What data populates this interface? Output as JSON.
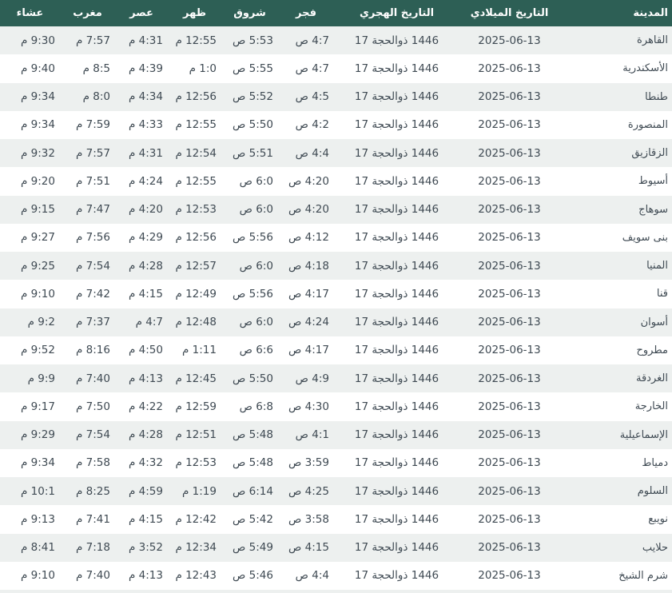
{
  "colors": {
    "header_bg": "#2d5f55",
    "header_text": "#ffffff",
    "row_alt_bg": "#edf0ef",
    "row_bg": "#ffffff",
    "cell_text": "#3f4a53"
  },
  "table": {
    "columns": [
      {
        "key": "isha",
        "label": "عشاء"
      },
      {
        "key": "maghrib",
        "label": "مغرب"
      },
      {
        "key": "asr",
        "label": "عصر"
      },
      {
        "key": "dhuhr",
        "label": "ظهر"
      },
      {
        "key": "sunrise",
        "label": "شروق"
      },
      {
        "key": "fajr",
        "label": "فجر"
      },
      {
        "key": "hijri",
        "label": "التاريخ الهجري"
      },
      {
        "key": "gregorian",
        "label": "التاريخ الميلادي"
      },
      {
        "key": "city",
        "label": "المدينة"
      }
    ],
    "rows": [
      {
        "city": "القاهرة",
        "gregorian": "2025-06-13",
        "hijri": [
          "17",
          "ذوالحجة",
          "1446"
        ],
        "fajr": "4:7 ص",
        "sunrise": "5:53 ص",
        "dhuhr": "12:55 م",
        "asr": "4:31 م",
        "maghrib": "7:57 م",
        "isha": "9:30 م"
      },
      {
        "city": "الأسكندرية",
        "gregorian": "2025-06-13",
        "hijri": [
          "17",
          "ذوالحجة",
          "1446"
        ],
        "fajr": "4:7 ص",
        "sunrise": "5:55 ص",
        "dhuhr": "1:0 م",
        "asr": "4:39 م",
        "maghrib": "8:5 م",
        "isha": "9:40 م"
      },
      {
        "city": "طنطا",
        "gregorian": "2025-06-13",
        "hijri": [
          "17",
          "ذوالحجة",
          "1446"
        ],
        "fajr": "4:5 ص",
        "sunrise": "5:52 ص",
        "dhuhr": "12:56 م",
        "asr": "4:34 م",
        "maghrib": "8:0 م",
        "isha": "9:34 م"
      },
      {
        "city": "المنصورة",
        "gregorian": "2025-06-13",
        "hijri": [
          "17",
          "ذوالحجة",
          "1446"
        ],
        "fajr": "4:2 ص",
        "sunrise": "5:50 ص",
        "dhuhr": "12:55 م",
        "asr": "4:33 م",
        "maghrib": "7:59 م",
        "isha": "9:34 م"
      },
      {
        "city": "الزقازيق",
        "gregorian": "2025-06-13",
        "hijri": [
          "17",
          "ذوالحجة",
          "1446"
        ],
        "fajr": "4:4 ص",
        "sunrise": "5:51 ص",
        "dhuhr": "12:54 م",
        "asr": "4:31 م",
        "maghrib": "7:57 م",
        "isha": "9:32 م"
      },
      {
        "city": "أسيوط",
        "gregorian": "2025-06-13",
        "hijri": [
          "17",
          "ذوالحجة",
          "1446"
        ],
        "fajr": "4:20 ص",
        "sunrise": "6:0 ص",
        "dhuhr": "12:55 م",
        "asr": "4:24 م",
        "maghrib": "7:51 م",
        "isha": "9:20 م"
      },
      {
        "city": "سوهاج",
        "gregorian": "2025-06-13",
        "hijri": [
          "17",
          "ذوالحجة",
          "1446"
        ],
        "fajr": "4:20 ص",
        "sunrise": "6:0 ص",
        "dhuhr": "12:53 م",
        "asr": "4:20 م",
        "maghrib": "7:47 م",
        "isha": "9:15 م"
      },
      {
        "city": "بنى سويف",
        "gregorian": "2025-06-13",
        "hijri": [
          "17",
          "ذوالحجة",
          "1446"
        ],
        "fajr": "4:12 ص",
        "sunrise": "5:56 ص",
        "dhuhr": "12:56 م",
        "asr": "4:29 م",
        "maghrib": "7:56 م",
        "isha": "9:27 م"
      },
      {
        "city": "المنيا",
        "gregorian": "2025-06-13",
        "hijri": [
          "17",
          "ذوالحجة",
          "1446"
        ],
        "fajr": "4:18 ص",
        "sunrise": "6:0 ص",
        "dhuhr": "12:57 م",
        "asr": "4:28 م",
        "maghrib": "7:54 م",
        "isha": "9:25 م"
      },
      {
        "city": "قنا",
        "gregorian": "2025-06-13",
        "hijri": [
          "17",
          "ذوالحجة",
          "1446"
        ],
        "fajr": "4:17 ص",
        "sunrise": "5:56 ص",
        "dhuhr": "12:49 م",
        "asr": "4:15 م",
        "maghrib": "7:42 م",
        "isha": "9:10 م"
      },
      {
        "city": "أسوان",
        "gregorian": "2025-06-13",
        "hijri": [
          "17",
          "ذوالحجة",
          "1446"
        ],
        "fajr": "4:24 ص",
        "sunrise": "6:0 ص",
        "dhuhr": "12:48 م",
        "asr": "4:7 م",
        "maghrib": "7:37 م",
        "isha": "9:2 م"
      },
      {
        "city": "مطروح",
        "gregorian": "2025-06-13",
        "hijri": [
          "17",
          "ذوالحجة",
          "1446"
        ],
        "fajr": "4:17 ص",
        "sunrise": "6:6 ص",
        "dhuhr": "1:11 م",
        "asr": "4:50 م",
        "maghrib": "8:16 م",
        "isha": "9:52 م"
      },
      {
        "city": "الغردقة",
        "gregorian": "2025-06-13",
        "hijri": [
          "17",
          "ذوالحجة",
          "1446"
        ],
        "fajr": "4:9 ص",
        "sunrise": "5:50 ص",
        "dhuhr": "12:45 م",
        "asr": "4:13 م",
        "maghrib": "7:40 م",
        "isha": "9:9 م"
      },
      {
        "city": "الخارجة",
        "gregorian": "2025-06-13",
        "hijri": [
          "17",
          "ذوالحجة",
          "1446"
        ],
        "fajr": "4:30 ص",
        "sunrise": "6:8 ص",
        "dhuhr": "12:59 م",
        "asr": "4:22 م",
        "maghrib": "7:50 م",
        "isha": "9:17 م"
      },
      {
        "city": "الإسماعيلية",
        "gregorian": "2025-06-13",
        "hijri": [
          "17",
          "ذوالحجة",
          "1446"
        ],
        "fajr": "4:1 ص",
        "sunrise": "5:48 ص",
        "dhuhr": "12:51 م",
        "asr": "4:28 م",
        "maghrib": "7:54 م",
        "isha": "9:29 م"
      },
      {
        "city": "دمياط",
        "gregorian": "2025-06-13",
        "hijri": [
          "17",
          "ذوالحجة",
          "1446"
        ],
        "fajr": "3:59 ص",
        "sunrise": "5:48 ص",
        "dhuhr": "12:53 م",
        "asr": "4:32 م",
        "maghrib": "7:58 م",
        "isha": "9:34 م"
      },
      {
        "city": "السلوم",
        "gregorian": "2025-06-13",
        "hijri": [
          "17",
          "ذوالحجة",
          "1446"
        ],
        "fajr": "4:25 ص",
        "sunrise": "6:14 ص",
        "dhuhr": "1:19 م",
        "asr": "4:59 م",
        "maghrib": "8:25 م",
        "isha": "10:1 م"
      },
      {
        "city": "نويبع",
        "gregorian": "2025-06-13",
        "hijri": [
          "17",
          "ذوالحجة",
          "1446"
        ],
        "fajr": "3:58 ص",
        "sunrise": "5:42 ص",
        "dhuhr": "12:42 م",
        "asr": "4:15 م",
        "maghrib": "7:41 م",
        "isha": "9:13 م"
      },
      {
        "city": "حلايب",
        "gregorian": "2025-06-13",
        "hijri": [
          "17",
          "ذوالحجة",
          "1446"
        ],
        "fajr": "4:15 ص",
        "sunrise": "5:49 ص",
        "dhuhr": "12:34 م",
        "asr": "3:52 م",
        "maghrib": "7:18 م",
        "isha": "8:41 م"
      },
      {
        "city": "شرم الشيخ",
        "gregorian": "2025-06-13",
        "hijri": [
          "17",
          "ذوالحجة",
          "1446"
        ],
        "fajr": "4:4 ص",
        "sunrise": "5:46 ص",
        "dhuhr": "12:43 م",
        "asr": "4:13 م",
        "maghrib": "7:40 م",
        "isha": "9:10 م"
      }
    ]
  }
}
